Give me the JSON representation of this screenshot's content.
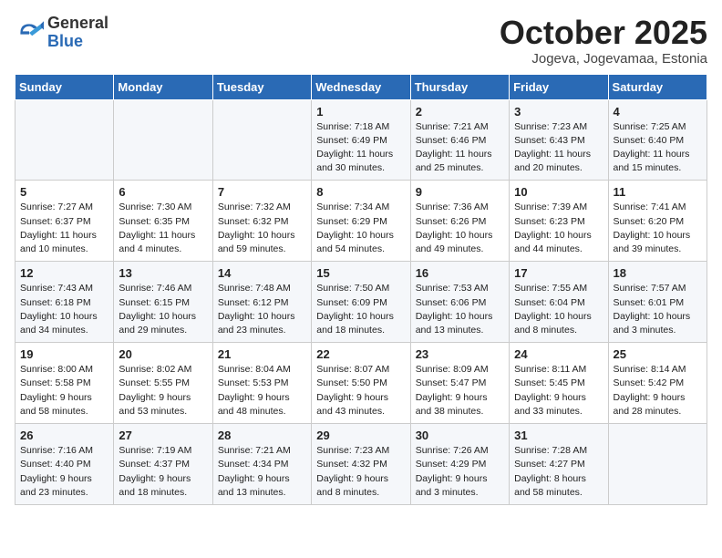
{
  "header": {
    "logo_general": "General",
    "logo_blue": "Blue",
    "month_title": "October 2025",
    "subtitle": "Jogeva, Jogevamaa, Estonia"
  },
  "days_of_week": [
    "Sunday",
    "Monday",
    "Tuesday",
    "Wednesday",
    "Thursday",
    "Friday",
    "Saturday"
  ],
  "weeks": [
    [
      {
        "day": "",
        "info": ""
      },
      {
        "day": "",
        "info": ""
      },
      {
        "day": "",
        "info": ""
      },
      {
        "day": "1",
        "info": "Sunrise: 7:18 AM\nSunset: 6:49 PM\nDaylight: 11 hours\nand 30 minutes."
      },
      {
        "day": "2",
        "info": "Sunrise: 7:21 AM\nSunset: 6:46 PM\nDaylight: 11 hours\nand 25 minutes."
      },
      {
        "day": "3",
        "info": "Sunrise: 7:23 AM\nSunset: 6:43 PM\nDaylight: 11 hours\nand 20 minutes."
      },
      {
        "day": "4",
        "info": "Sunrise: 7:25 AM\nSunset: 6:40 PM\nDaylight: 11 hours\nand 15 minutes."
      }
    ],
    [
      {
        "day": "5",
        "info": "Sunrise: 7:27 AM\nSunset: 6:37 PM\nDaylight: 11 hours\nand 10 minutes."
      },
      {
        "day": "6",
        "info": "Sunrise: 7:30 AM\nSunset: 6:35 PM\nDaylight: 11 hours\nand 4 minutes."
      },
      {
        "day": "7",
        "info": "Sunrise: 7:32 AM\nSunset: 6:32 PM\nDaylight: 10 hours\nand 59 minutes."
      },
      {
        "day": "8",
        "info": "Sunrise: 7:34 AM\nSunset: 6:29 PM\nDaylight: 10 hours\nand 54 minutes."
      },
      {
        "day": "9",
        "info": "Sunrise: 7:36 AM\nSunset: 6:26 PM\nDaylight: 10 hours\nand 49 minutes."
      },
      {
        "day": "10",
        "info": "Sunrise: 7:39 AM\nSunset: 6:23 PM\nDaylight: 10 hours\nand 44 minutes."
      },
      {
        "day": "11",
        "info": "Sunrise: 7:41 AM\nSunset: 6:20 PM\nDaylight: 10 hours\nand 39 minutes."
      }
    ],
    [
      {
        "day": "12",
        "info": "Sunrise: 7:43 AM\nSunset: 6:18 PM\nDaylight: 10 hours\nand 34 minutes."
      },
      {
        "day": "13",
        "info": "Sunrise: 7:46 AM\nSunset: 6:15 PM\nDaylight: 10 hours\nand 29 minutes."
      },
      {
        "day": "14",
        "info": "Sunrise: 7:48 AM\nSunset: 6:12 PM\nDaylight: 10 hours\nand 23 minutes."
      },
      {
        "day": "15",
        "info": "Sunrise: 7:50 AM\nSunset: 6:09 PM\nDaylight: 10 hours\nand 18 minutes."
      },
      {
        "day": "16",
        "info": "Sunrise: 7:53 AM\nSunset: 6:06 PM\nDaylight: 10 hours\nand 13 minutes."
      },
      {
        "day": "17",
        "info": "Sunrise: 7:55 AM\nSunset: 6:04 PM\nDaylight: 10 hours\nand 8 minutes."
      },
      {
        "day": "18",
        "info": "Sunrise: 7:57 AM\nSunset: 6:01 PM\nDaylight: 10 hours\nand 3 minutes."
      }
    ],
    [
      {
        "day": "19",
        "info": "Sunrise: 8:00 AM\nSunset: 5:58 PM\nDaylight: 9 hours\nand 58 minutes."
      },
      {
        "day": "20",
        "info": "Sunrise: 8:02 AM\nSunset: 5:55 PM\nDaylight: 9 hours\nand 53 minutes."
      },
      {
        "day": "21",
        "info": "Sunrise: 8:04 AM\nSunset: 5:53 PM\nDaylight: 9 hours\nand 48 minutes."
      },
      {
        "day": "22",
        "info": "Sunrise: 8:07 AM\nSunset: 5:50 PM\nDaylight: 9 hours\nand 43 minutes."
      },
      {
        "day": "23",
        "info": "Sunrise: 8:09 AM\nSunset: 5:47 PM\nDaylight: 9 hours\nand 38 minutes."
      },
      {
        "day": "24",
        "info": "Sunrise: 8:11 AM\nSunset: 5:45 PM\nDaylight: 9 hours\nand 33 minutes."
      },
      {
        "day": "25",
        "info": "Sunrise: 8:14 AM\nSunset: 5:42 PM\nDaylight: 9 hours\nand 28 minutes."
      }
    ],
    [
      {
        "day": "26",
        "info": "Sunrise: 7:16 AM\nSunset: 4:40 PM\nDaylight: 9 hours\nand 23 minutes."
      },
      {
        "day": "27",
        "info": "Sunrise: 7:19 AM\nSunset: 4:37 PM\nDaylight: 9 hours\nand 18 minutes."
      },
      {
        "day": "28",
        "info": "Sunrise: 7:21 AM\nSunset: 4:34 PM\nDaylight: 9 hours\nand 13 minutes."
      },
      {
        "day": "29",
        "info": "Sunrise: 7:23 AM\nSunset: 4:32 PM\nDaylight: 9 hours\nand 8 minutes."
      },
      {
        "day": "30",
        "info": "Sunrise: 7:26 AM\nSunset: 4:29 PM\nDaylight: 9 hours\nand 3 minutes."
      },
      {
        "day": "31",
        "info": "Sunrise: 7:28 AM\nSunset: 4:27 PM\nDaylight: 8 hours\nand 58 minutes."
      },
      {
        "day": "",
        "info": ""
      }
    ]
  ]
}
